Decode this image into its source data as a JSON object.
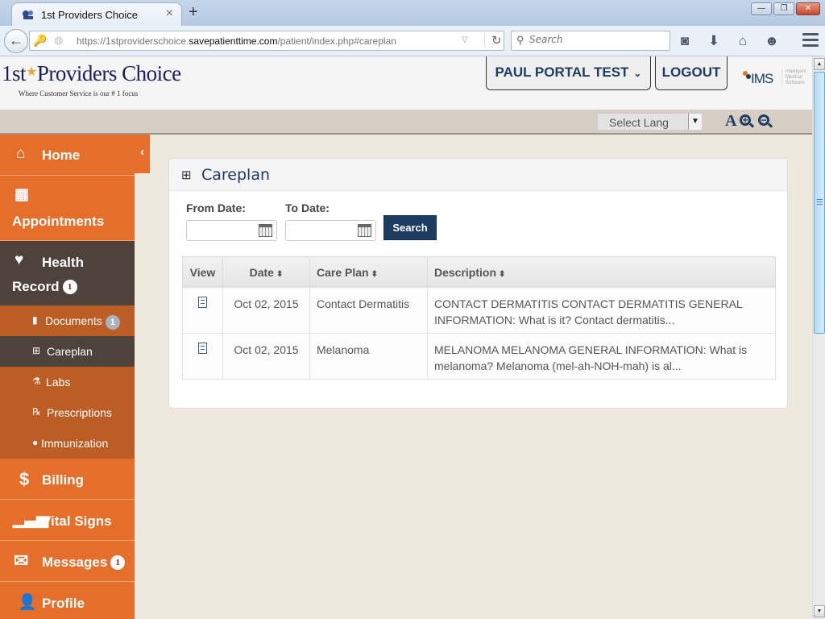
{
  "browser": {
    "tab_title": "1st Providers Choice",
    "tab_close": "×",
    "new_tab": "+",
    "url_prefix": "https://1stproviderschoice.",
    "url_domain": "savepatienttime.com",
    "url_path": "/patient/index.php#careplan",
    "search_placeholder": "Search",
    "window_buttons": {
      "minimize": "—",
      "restore": "❐",
      "close": "✕"
    }
  },
  "header": {
    "logo_title_1": "1st",
    "logo_star": "★",
    "logo_title_2": "Providers Choice",
    "logo_tagline": "Where Customer Service is our # 1 focus",
    "user_name": "PAUL PORTAL TEST",
    "user_chevron": "⌄",
    "logout_label": "LOGOUT",
    "partner_logo": "IMS",
    "partner_sub": "Intelligent Medical Software"
  },
  "toolbar": {
    "language_select": "Select Lang",
    "font_size_label": "A",
    "zoom_in": "+",
    "zoom_out": "−"
  },
  "sidebar": {
    "toggle": "‹",
    "items": [
      {
        "label": "Home",
        "icon": "home-icon"
      },
      {
        "label": "Appointments",
        "icon": "calendar-icon"
      },
      {
        "label_1": "Health",
        "label_2": "Record",
        "badge": "1",
        "icon": "heartbeat-icon"
      },
      {
        "label": "Billing",
        "icon": "dollar-icon"
      },
      {
        "label": "Vital Signs",
        "icon": "bar-chart-icon"
      },
      {
        "label": "Messages",
        "badge": "1",
        "icon": "envelope-icon"
      },
      {
        "label": "Profile",
        "icon": "user-icon"
      }
    ],
    "sub_items": [
      {
        "label": "Documents",
        "badge": "1",
        "icon": "file-icon"
      },
      {
        "label": "Careplan",
        "icon": "medkit-icon",
        "active": true
      },
      {
        "label": "Labs",
        "icon": "flask-icon"
      },
      {
        "label": "Prescriptions",
        "icon": "prescription-icon"
      },
      {
        "label": "Immunization",
        "icon": "drop-icon"
      }
    ]
  },
  "careplan": {
    "title": "Careplan",
    "from_label": "From Date:",
    "to_label": "To Date:",
    "from_value": "",
    "to_value": "",
    "search_label": "Search",
    "columns": [
      "View",
      "Date",
      "Care Plan",
      "Description"
    ],
    "sort_glyph": "⬍",
    "rows": [
      {
        "date": "Oct 02, 2015",
        "care_plan": "Contact Dermatitis",
        "description": "CONTACT DERMATITIS CONTACT DERMATITIS GENERAL INFORMATION: What is it? Contact dermatitis..."
      },
      {
        "date": "Oct 02, 2015",
        "care_plan": "Melanoma",
        "description": "MELANOMA MELANOMA GENERAL INFORMATION: What is melanoma? Melanoma (mel-ah-NOH-mah) is al..."
      }
    ]
  },
  "colors": {
    "sidebar_orange": "#e46e2a",
    "sidebar_sub": "#bd5d26",
    "active_dark": "#4e433c",
    "navy": "#1d3c63",
    "page_bg": "#efe8dd"
  }
}
